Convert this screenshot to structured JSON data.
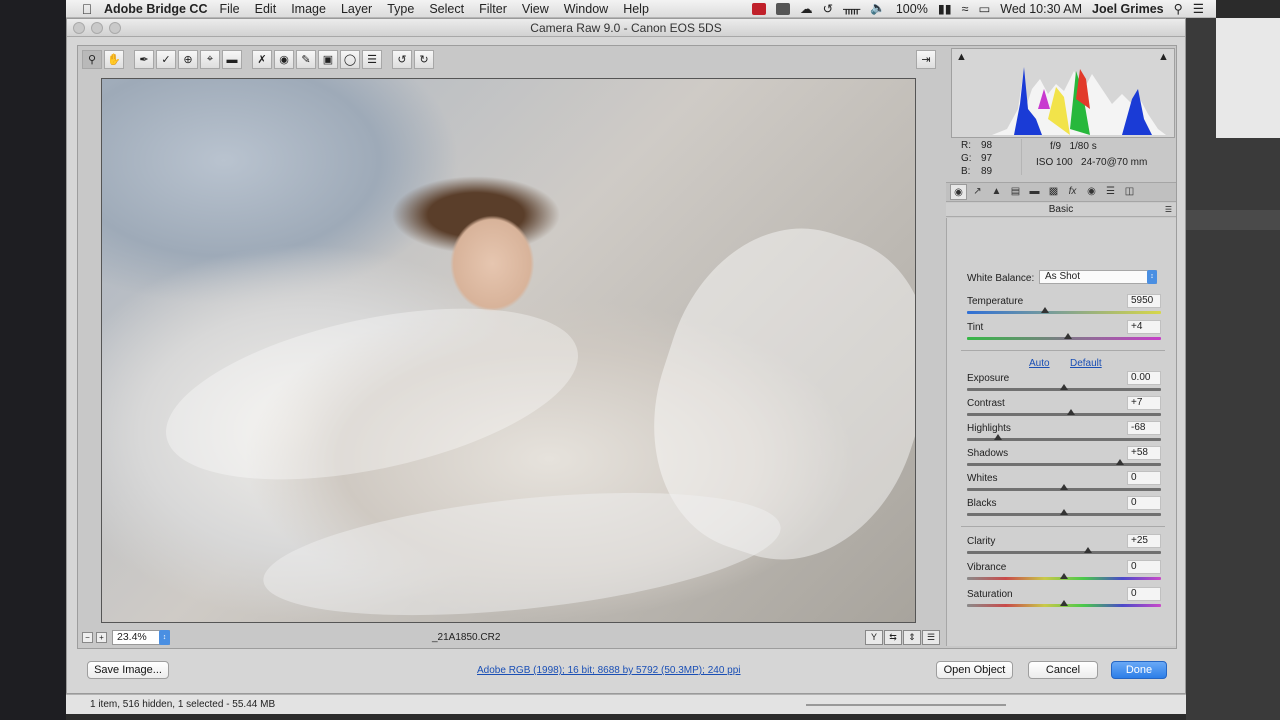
{
  "menubar": {
    "app_name": "Adobe Bridge CC",
    "menus": [
      "File",
      "Edit",
      "Image",
      "Layer",
      "Type",
      "Select",
      "Filter",
      "View",
      "Window",
      "Help"
    ],
    "battery": "100%",
    "clock": "Wed 10:30 AM",
    "user": "Joel Grimes"
  },
  "window": {
    "title": "Camera Raw 9.0  -  Canon EOS 5DS"
  },
  "toolbar": {
    "tools": [
      "zoom-icon",
      "hand-icon",
      "white-balance-icon",
      "color-sampler-icon",
      "target-adjust-icon",
      "crop-icon",
      "straighten-icon",
      "spot-removal-icon",
      "red-eye-icon",
      "adjustment-brush-icon",
      "graduated-filter-icon",
      "radial-filter-icon",
      "preferences-icon",
      "rotate-ccw-icon",
      "rotate-cw-icon"
    ]
  },
  "image_bar": {
    "zoom": "23.4%",
    "filename": "_21A1850.CR2"
  },
  "info": {
    "r_label": "R:",
    "r_value": "98",
    "g_label": "G:",
    "g_value": "97",
    "b_label": "B:",
    "b_value": "89",
    "aperture": "f/9",
    "shutter": "1/80 s",
    "iso": "ISO 100",
    "lens": "24-70@70 mm"
  },
  "panel": {
    "title": "Basic",
    "white_balance_label": "White Balance:",
    "white_balance_value": "As Shot",
    "auto_label": "Auto",
    "default_label": "Default",
    "sliders": {
      "temperature": {
        "label": "Temperature",
        "value": "5950",
        "position": 0.4
      },
      "tint": {
        "label": "Tint",
        "value": "+4",
        "position": 0.52
      },
      "exposure": {
        "label": "Exposure",
        "value": "0.00",
        "position": 0.5
      },
      "contrast": {
        "label": "Contrast",
        "value": "+7",
        "position": 0.535
      },
      "highlights": {
        "label": "Highlights",
        "value": "-68",
        "position": 0.16
      },
      "shadows": {
        "label": "Shadows",
        "value": "+58",
        "position": 0.79
      },
      "whites": {
        "label": "Whites",
        "value": "0",
        "position": 0.5
      },
      "blacks": {
        "label": "Blacks",
        "value": "0",
        "position": 0.5
      },
      "clarity": {
        "label": "Clarity",
        "value": "+25",
        "position": 0.625
      },
      "vibrance": {
        "label": "Vibrance",
        "value": "0",
        "position": 0.5
      },
      "saturation": {
        "label": "Saturation",
        "value": "0",
        "position": 0.5
      }
    }
  },
  "footer": {
    "save_label": "Save Image...",
    "workflow_text": "Adobe RGB (1998); 16 bit; 8688 by 5792 (50.3MP); 240 ppi",
    "open_label": "Open Object",
    "cancel_label": "Cancel",
    "done_label": "Done"
  },
  "statusbar": {
    "text": "1 item, 516 hidden, 1 selected - 55.44 MB"
  },
  "colors": {
    "accent": "#2c7ee8",
    "link": "#1a4fb5"
  }
}
